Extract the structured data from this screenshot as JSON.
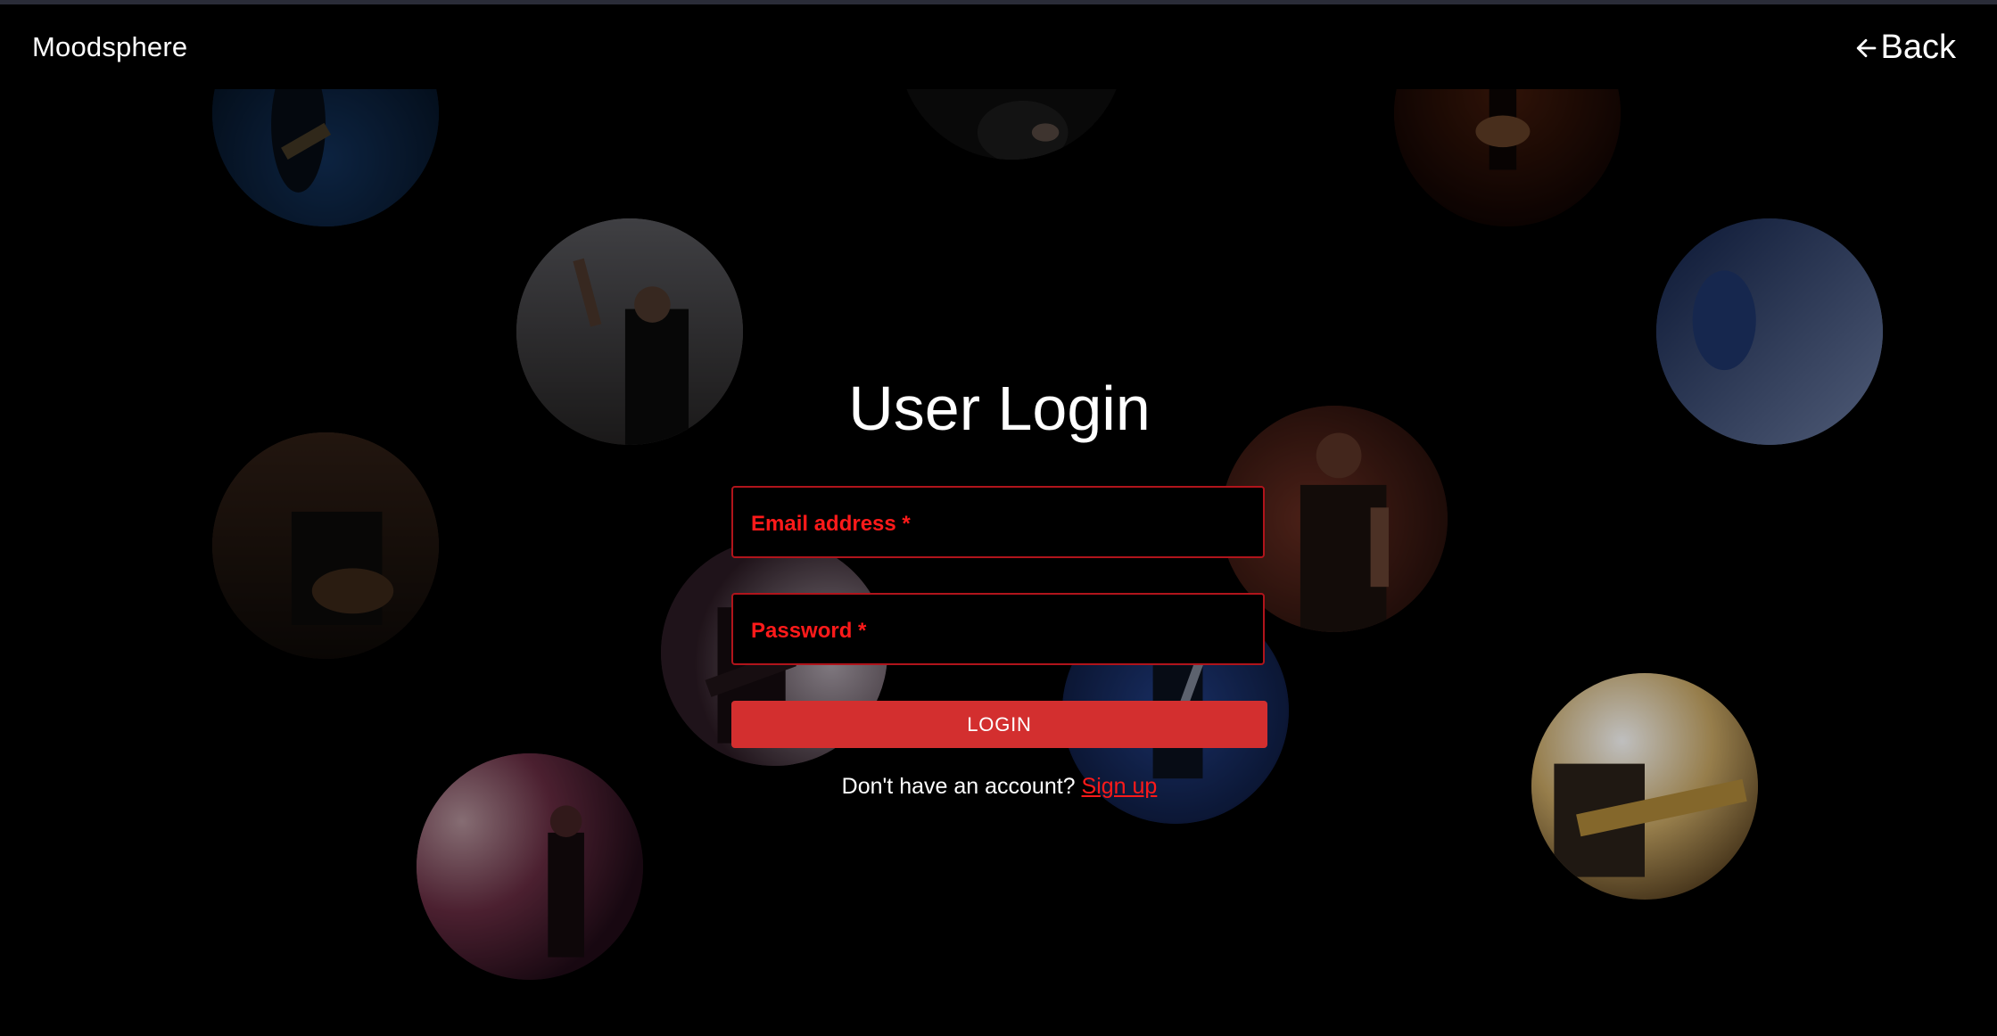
{
  "header": {
    "brand": "Moodsphere",
    "back_label": "Back"
  },
  "login": {
    "title": "User Login",
    "email_label": "Email address *",
    "password_label": "Password *",
    "submit_label": "LOGIN",
    "signup_prompt": "Don't have an account?",
    "signup_link": "Sign up"
  },
  "colors": {
    "accent": "#d32f2f",
    "label_red": "#ff1a1a",
    "border_red": "#b0141b",
    "background": "#000000"
  }
}
